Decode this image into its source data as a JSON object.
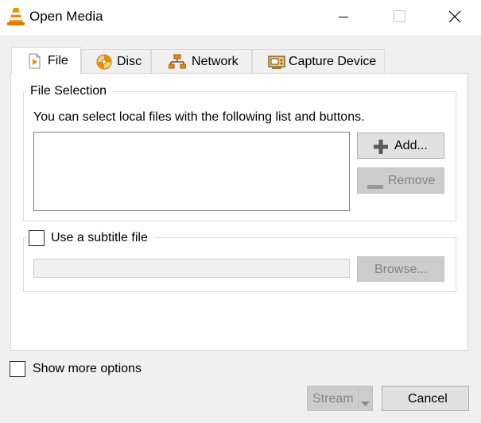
{
  "window": {
    "title": "Open Media",
    "controls": {
      "minimize": "minimize-icon",
      "maximize": "maximize-icon",
      "close": "close-icon"
    }
  },
  "tabs": [
    {
      "label": "File",
      "icon": "file-icon",
      "active": true
    },
    {
      "label": "Disc",
      "icon": "disc-icon",
      "active": false
    },
    {
      "label": "Network",
      "icon": "network-icon",
      "active": false
    },
    {
      "label": "Capture Device",
      "icon": "capture-device-icon",
      "active": false
    }
  ],
  "file_selection": {
    "group_title": "File Selection",
    "description": "You can select local files with the following list and buttons.",
    "add_label": "Add...",
    "remove_label": "Remove"
  },
  "subtitle": {
    "checkbox_label": "Use a subtitle file",
    "checked": false,
    "path_value": "",
    "browse_label": "Browse..."
  },
  "footer": {
    "show_more_label": "Show more options",
    "show_more_checked": false,
    "stream_label": "Stream",
    "cancel_label": "Cancel"
  },
  "colors": {
    "accent_orange": "#f08c00",
    "disabled_text": "#838383",
    "panel_bg": "#ffffff",
    "window_bg": "#f0f0f0"
  }
}
